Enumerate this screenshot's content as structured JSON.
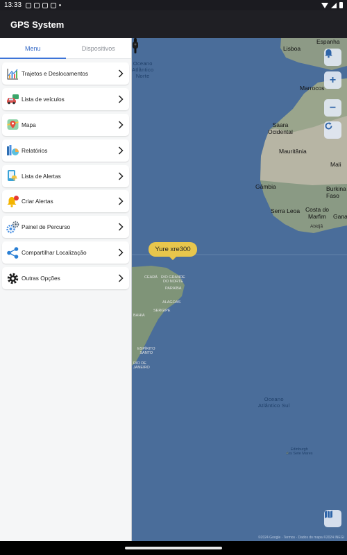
{
  "status_bar": {
    "time": "13:33"
  },
  "app_bar": {
    "title": "GPS System"
  },
  "tabs": [
    {
      "label": "Menu",
      "active": true
    },
    {
      "label": "Dispositivos",
      "active": false
    }
  ],
  "menu": [
    {
      "label": "Trajetos e Deslocamentos",
      "icon": "line-chart-icon"
    },
    {
      "label": "Lista de veículos",
      "icon": "car-icon"
    },
    {
      "label": "Mapa",
      "icon": "map-pin-icon"
    },
    {
      "label": "Relatórios",
      "icon": "report-pie-icon"
    },
    {
      "label": "Lista de Alertas",
      "icon": "alert-list-icon"
    },
    {
      "label": "Criar Alertas",
      "icon": "bell-icon"
    },
    {
      "label": "Painel de Percurso",
      "icon": "gears-icon"
    },
    {
      "label": "Compartilhar Localização",
      "icon": "share-icon"
    },
    {
      "label": "Outras Opções",
      "icon": "settings-icon"
    }
  ],
  "map": {
    "vehicle_label": "Yure xre300",
    "labels": {
      "lisboa": "Lisboa",
      "espanha": "Espanha",
      "ocean_north": "Oceano\nAtlântico\nNorte",
      "marrocos": "Marrocos",
      "saara": "Saara\nOcidental",
      "mauritania": "Mauritânia",
      "mali": "Mali",
      "gambia": "Gâmbia",
      "burkina": "Burkina\nFaso",
      "serra_leoa": "Serra Leoa",
      "costa_marfim": "Costa do\nMarfim",
      "gana": "Gana",
      "abidja": "Abidjã",
      "ceara": "CEARÁ",
      "rio_grande": "RIO GRANDE\nDO NORTE",
      "paraiba": "PARAÍBA",
      "alagoas": "ALAGOAS",
      "sergipe": "SERGIPE",
      "bahia": "BAHIA",
      "espirito_santo": "ESPÍRITO\nSANTO",
      "rio_janeiro": "RIO DE\nJANEIRO",
      "ocean_south": "Oceano\nAtlântico Sul",
      "edinburgh": "Edinburgh\ndos Sete Mares"
    },
    "attribution": "©2024 Google · Termos · Dados do mapa ©2024 INEGI",
    "colors": {
      "water": "#4a6d9a",
      "land": "#8a9a84",
      "desert": "#b7b5a4"
    }
  },
  "accent": "#3d74d8"
}
